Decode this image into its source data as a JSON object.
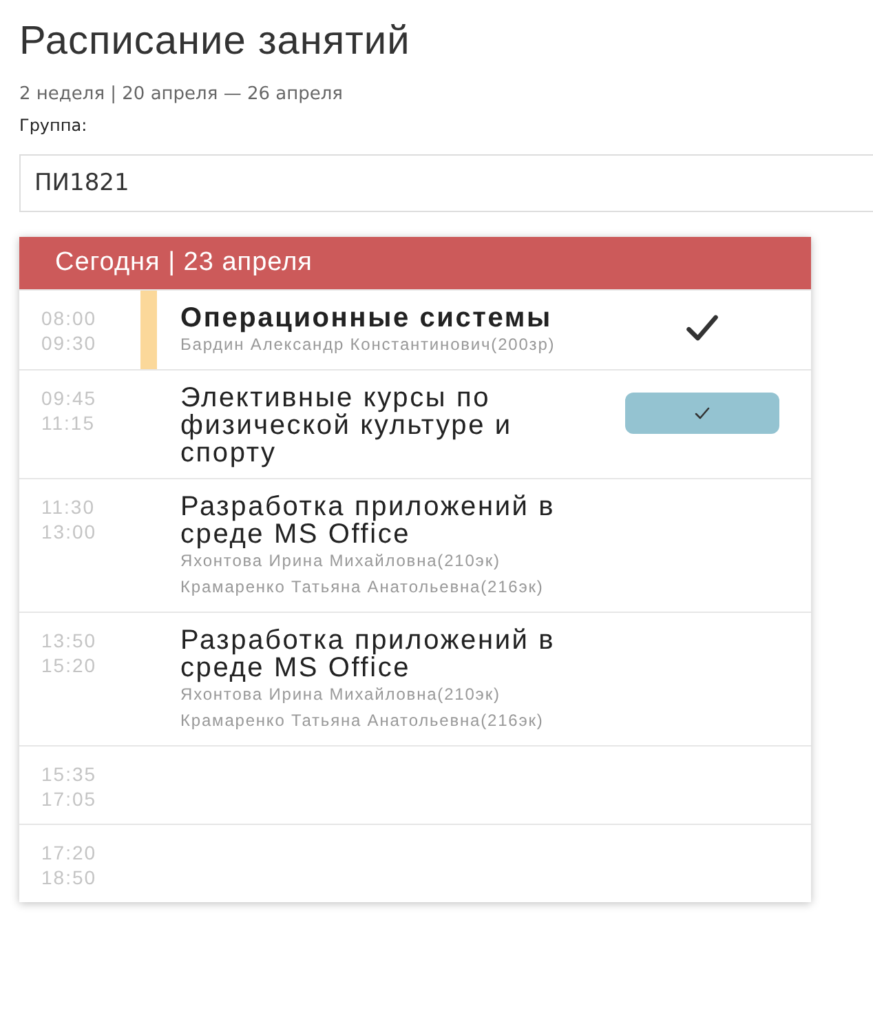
{
  "title": "Расписание занятий",
  "week": "2 неделя | 20 апреля — 26 апреля",
  "group": {
    "label": "Группа:",
    "value": "ПИ1821"
  },
  "day": {
    "header": "Сегодня | 23 апреля",
    "lessons": [
      {
        "start": "08:00",
        "end": "09:30",
        "current": true,
        "subject": "Операционные системы",
        "teachers": [
          "Бардин Александр Константинович(200зр)"
        ],
        "kind": "tick"
      },
      {
        "start": "09:45",
        "end": "11:15",
        "current": false,
        "subject": "Элективные курсы по физической культуре и спорту",
        "kind": "button"
      },
      {
        "start": "11:30",
        "end": "13:00",
        "current": false,
        "subject": "Разработка приложений в среде MS Office",
        "teachers": [
          "Яхонтова Ирина Михайловна(210эк)",
          "Крамаренко Татьяна Анатольевна(216эк)"
        ]
      },
      {
        "start": "13:50",
        "end": "15:20",
        "current": false,
        "subject": "Разработка приложений в среде MS Office",
        "teachers": [
          "Яхонтова Ирина Михайловна(210эк)",
          "Крамаренко Татьяна Анатольевна(216эк)"
        ]
      },
      {
        "start": "15:35",
        "end": "17:05",
        "current": false
      },
      {
        "start": "17:20",
        "end": "18:50",
        "current": false
      }
    ]
  }
}
